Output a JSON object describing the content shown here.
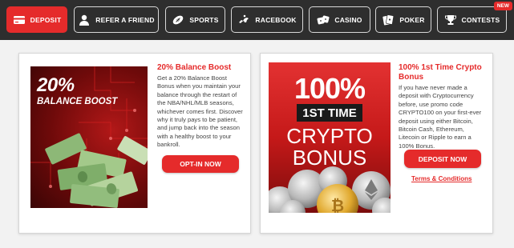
{
  "nav": {
    "tabs": [
      {
        "label": "DEPOSIT",
        "icon": "credit-card-icon",
        "active": true
      },
      {
        "label": "REFER A FRIEND",
        "icon": "user-icon",
        "active": false
      },
      {
        "label": "SPORTS",
        "icon": "football-icon",
        "active": false
      },
      {
        "label": "RACEBOOK",
        "icon": "horse-racing-icon",
        "active": false
      },
      {
        "label": "CASINO",
        "icon": "dice-icon",
        "active": false
      },
      {
        "label": "POKER",
        "icon": "playing-cards-icon",
        "active": false
      },
      {
        "label": "CONTESTS",
        "icon": "trophy-icon",
        "active": false,
        "badge": "NEW"
      }
    ]
  },
  "colors": {
    "accent": "#e52b2b",
    "nav_bg": "#2e2e2e",
    "page_bg": "#f2f2f2"
  },
  "promos": [
    {
      "image_line1": "20%",
      "image_line2": "BALANCE BOOST",
      "title": "20% Balance Boost",
      "description": "Get a 20% Balance Boost Bonus when you maintain your balance through the restart of the NBA/NHL/MLB seasons, whichever comes first. Discover why it truly pays to be patient, and jump back into the season with a healthy boost to your bankroll.",
      "button_label": "OPT-IN NOW"
    },
    {
      "image_line1": "100%",
      "image_line2": "1ST TIME",
      "image_line3": "CRYPTO",
      "image_line4": "BONUS",
      "title": "100% 1st Time Crypto Bonus",
      "description": "If you have never made a deposit with Cryptocurrency before, use promo code CRYPTO100 on your first-ever deposit using either Bitcoin, Bitcoin Cash, Ethereum, Litecoin or Ripple to earn a 100% Bonus.",
      "button_label": "DEPOSIT NOW",
      "link_label": "Terms & Conditions"
    }
  ]
}
